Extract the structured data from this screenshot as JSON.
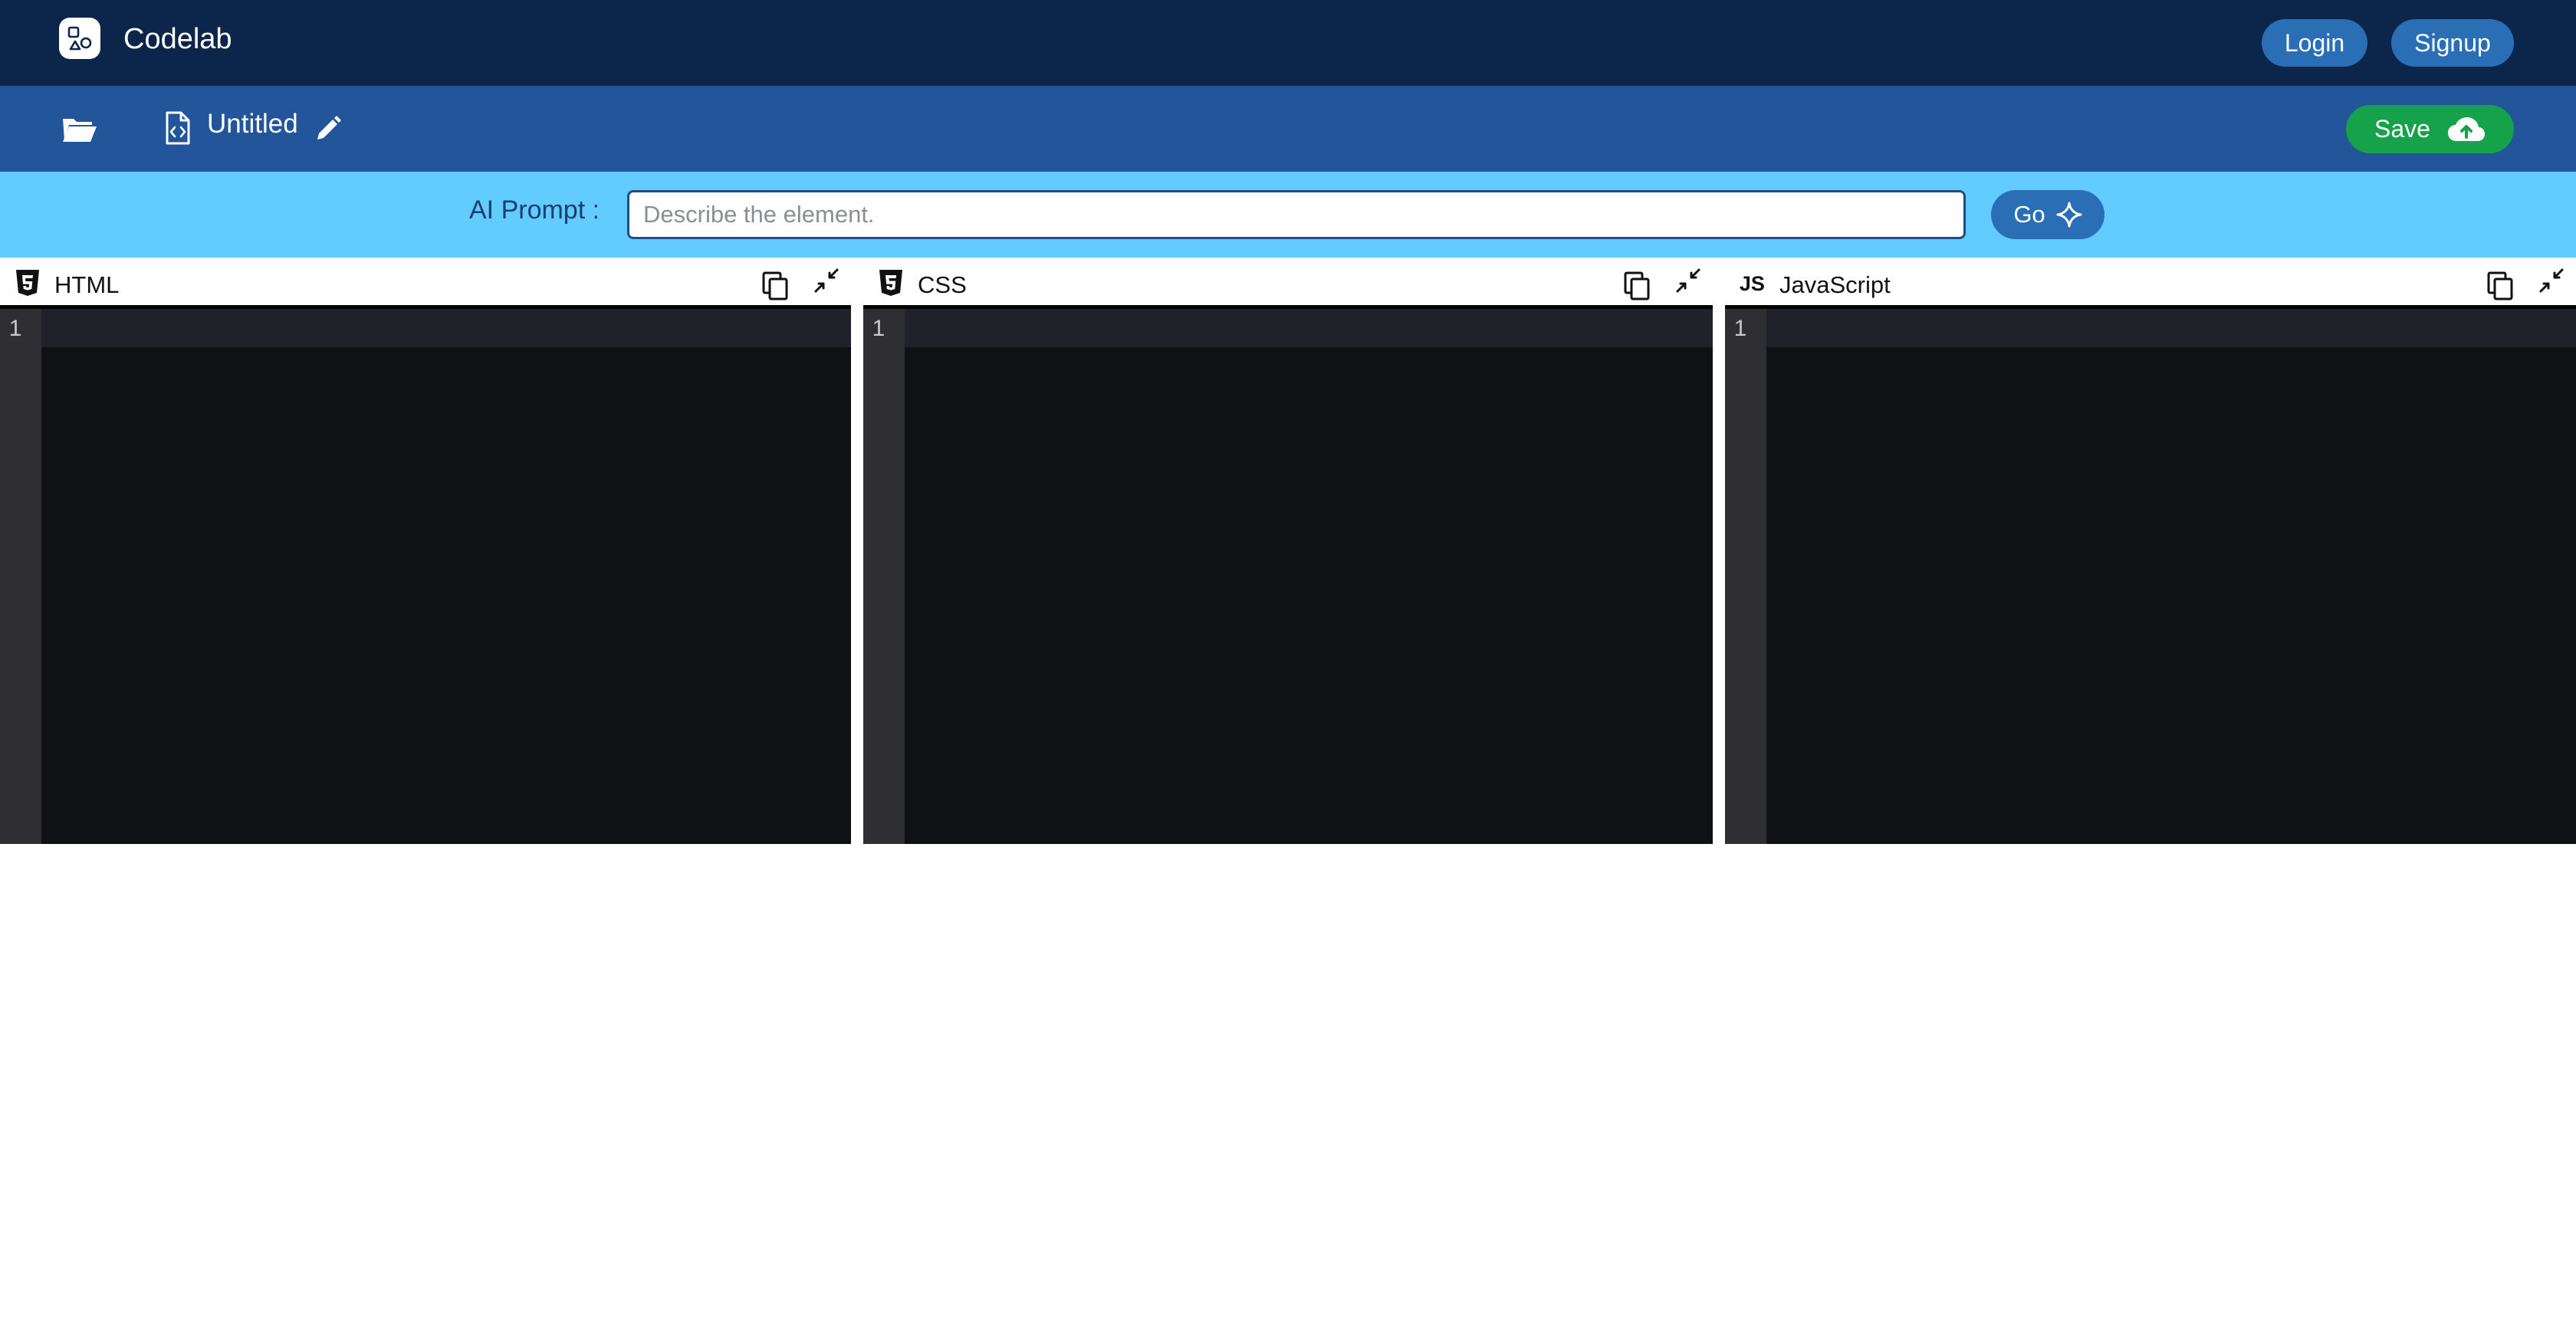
{
  "app": {
    "name": "Codelab",
    "logo_icon": "codelab-logo-icon",
    "login_label": "Login",
    "signup_label": "Signup"
  },
  "filebar": {
    "folder_icon": "folder-open-icon",
    "file_icon": "file-code-icon",
    "file_title": "Untitled",
    "edit_icon": "pencil-icon",
    "save_label": "Save",
    "save_icon": "cloud-upload-icon"
  },
  "prompt": {
    "label": "AI Prompt :",
    "value": "",
    "placeholder": "Describe the element.",
    "go_label": "Go",
    "go_icon": "sparkle-icon"
  },
  "editors": [
    {
      "label": "HTML",
      "icon": "html5-icon",
      "line_numbers": [
        "1"
      ],
      "content": ""
    },
    {
      "label": "CSS",
      "icon": "css3-icon",
      "line_numbers": [
        "1"
      ],
      "content": ""
    },
    {
      "label": "JavaScript",
      "icon": "js-icon",
      "line_numbers": [
        "1"
      ],
      "content": ""
    }
  ],
  "colors": {
    "topbar": "#0b264a",
    "filebar": "#22559a",
    "promptbar": "#62cbff",
    "button_blue": "#2a6fb6",
    "save_green": "#16a24a",
    "editor_bg": "#0f1115",
    "gutter_bg": "#2f2e33"
  }
}
